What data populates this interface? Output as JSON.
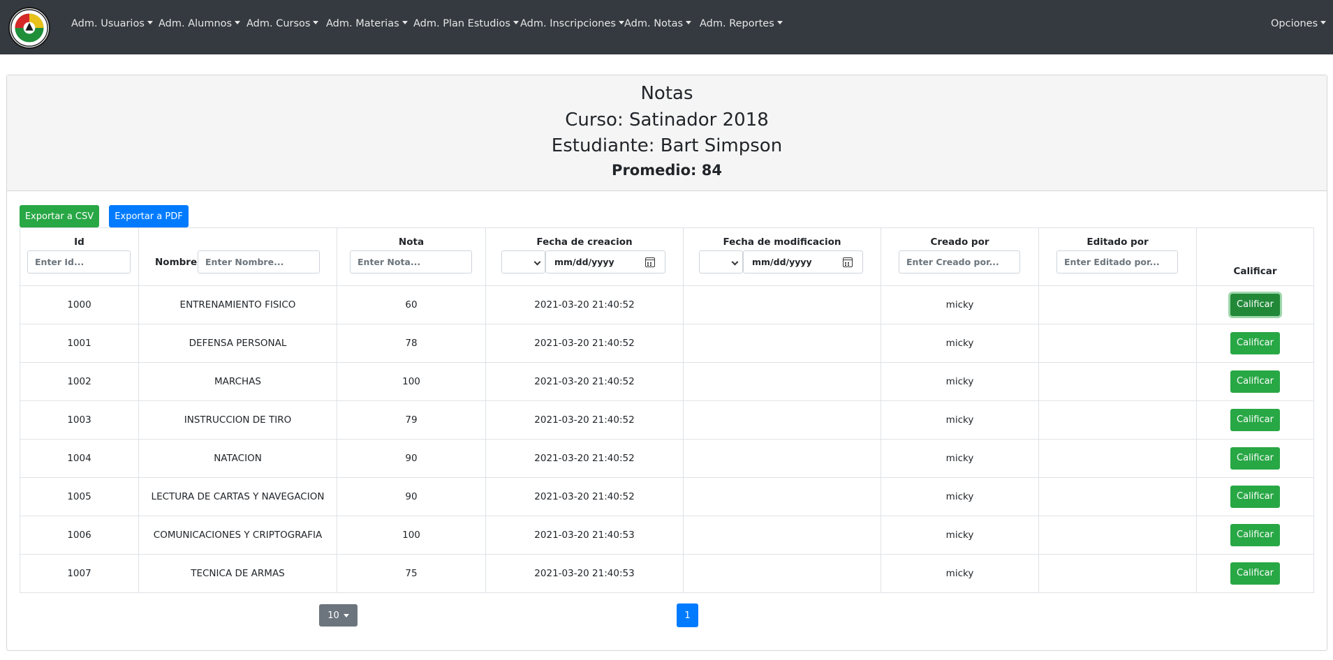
{
  "nav": {
    "items": [
      {
        "label": "Adm. Usuarios"
      },
      {
        "label": "Adm. Alumnos"
      },
      {
        "label": "Adm. Cursos"
      },
      {
        "label": "Adm. Materias"
      },
      {
        "label": "Adm. Plan Estudios"
      },
      {
        "label": "Adm. Inscripciones"
      },
      {
        "label": "Adm. Notas"
      },
      {
        "label": "Adm. Reportes"
      }
    ],
    "options_label": "Opciones"
  },
  "header": {
    "title": "Notas",
    "course": "Curso: Satinador 2018",
    "student": "Estudiante: Bart Simpson",
    "average": "Promedio: 84"
  },
  "actions": {
    "export_csv": "Exportar a CSV",
    "export_pdf": "Exportar a PDF"
  },
  "table": {
    "columns": {
      "id": {
        "label": "Id",
        "placeholder": "Enter Id..."
      },
      "nombre": {
        "label": "Nombre",
        "placeholder": "Enter Nombre..."
      },
      "nota": {
        "label": "Nota",
        "placeholder": "Enter Nota..."
      },
      "fecha_creacion": {
        "label": "Fecha de creacion",
        "date_placeholder": "mm/dd/yyyy"
      },
      "fecha_modificacion": {
        "label": "Fecha de modificacion",
        "date_placeholder": "mm/dd/yyyy"
      },
      "creado_por": {
        "label": "Creado por",
        "placeholder": "Enter Creado por..."
      },
      "editado_por": {
        "label": "Editado por",
        "placeholder": "Enter Editado por..."
      },
      "calificar": {
        "label": "Calificar"
      }
    },
    "rows": [
      {
        "id": "1000",
        "nombre": "ENTRENAMIENTO FISICO",
        "nota": "60",
        "fecha_creacion": "2021-03-20 21:40:52",
        "fecha_modificacion": "",
        "creado_por": "micky",
        "editado_por": "",
        "action": "Calificar"
      },
      {
        "id": "1001",
        "nombre": "DEFENSA PERSONAL",
        "nota": "78",
        "fecha_creacion": "2021-03-20 21:40:52",
        "fecha_modificacion": "",
        "creado_por": "micky",
        "editado_por": "",
        "action": "Calificar"
      },
      {
        "id": "1002",
        "nombre": "MARCHAS",
        "nota": "100",
        "fecha_creacion": "2021-03-20 21:40:52",
        "fecha_modificacion": "",
        "creado_por": "micky",
        "editado_por": "",
        "action": "Calificar"
      },
      {
        "id": "1003",
        "nombre": "INSTRUCCION DE TIRO",
        "nota": "79",
        "fecha_creacion": "2021-03-20 21:40:52",
        "fecha_modificacion": "",
        "creado_por": "micky",
        "editado_por": "",
        "action": "Calificar"
      },
      {
        "id": "1004",
        "nombre": "NATACION",
        "nota": "90",
        "fecha_creacion": "2021-03-20 21:40:52",
        "fecha_modificacion": "",
        "creado_por": "micky",
        "editado_por": "",
        "action": "Calificar"
      },
      {
        "id": "1005",
        "nombre": "LECTURA DE CARTAS Y NAVEGACION",
        "nota": "90",
        "fecha_creacion": "2021-03-20 21:40:52",
        "fecha_modificacion": "",
        "creado_por": "micky",
        "editado_por": "",
        "action": "Calificar"
      },
      {
        "id": "1006",
        "nombre": "COMUNICACIONES Y CRIPTOGRAFIA",
        "nota": "100",
        "fecha_creacion": "2021-03-20 21:40:53",
        "fecha_modificacion": "",
        "creado_por": "micky",
        "editado_por": "",
        "action": "Calificar"
      },
      {
        "id": "1007",
        "nombre": "TECNICA DE ARMAS",
        "nota": "75",
        "fecha_creacion": "2021-03-20 21:40:53",
        "fecha_modificacion": "",
        "creado_por": "micky",
        "editado_por": "",
        "action": "Calificar"
      }
    ]
  },
  "pagination": {
    "page_size": "10",
    "current_page": "1"
  },
  "colors": {
    "navbar": "#343a40",
    "success": "#28a745",
    "primary": "#007bff",
    "secondary": "#6c757d"
  }
}
